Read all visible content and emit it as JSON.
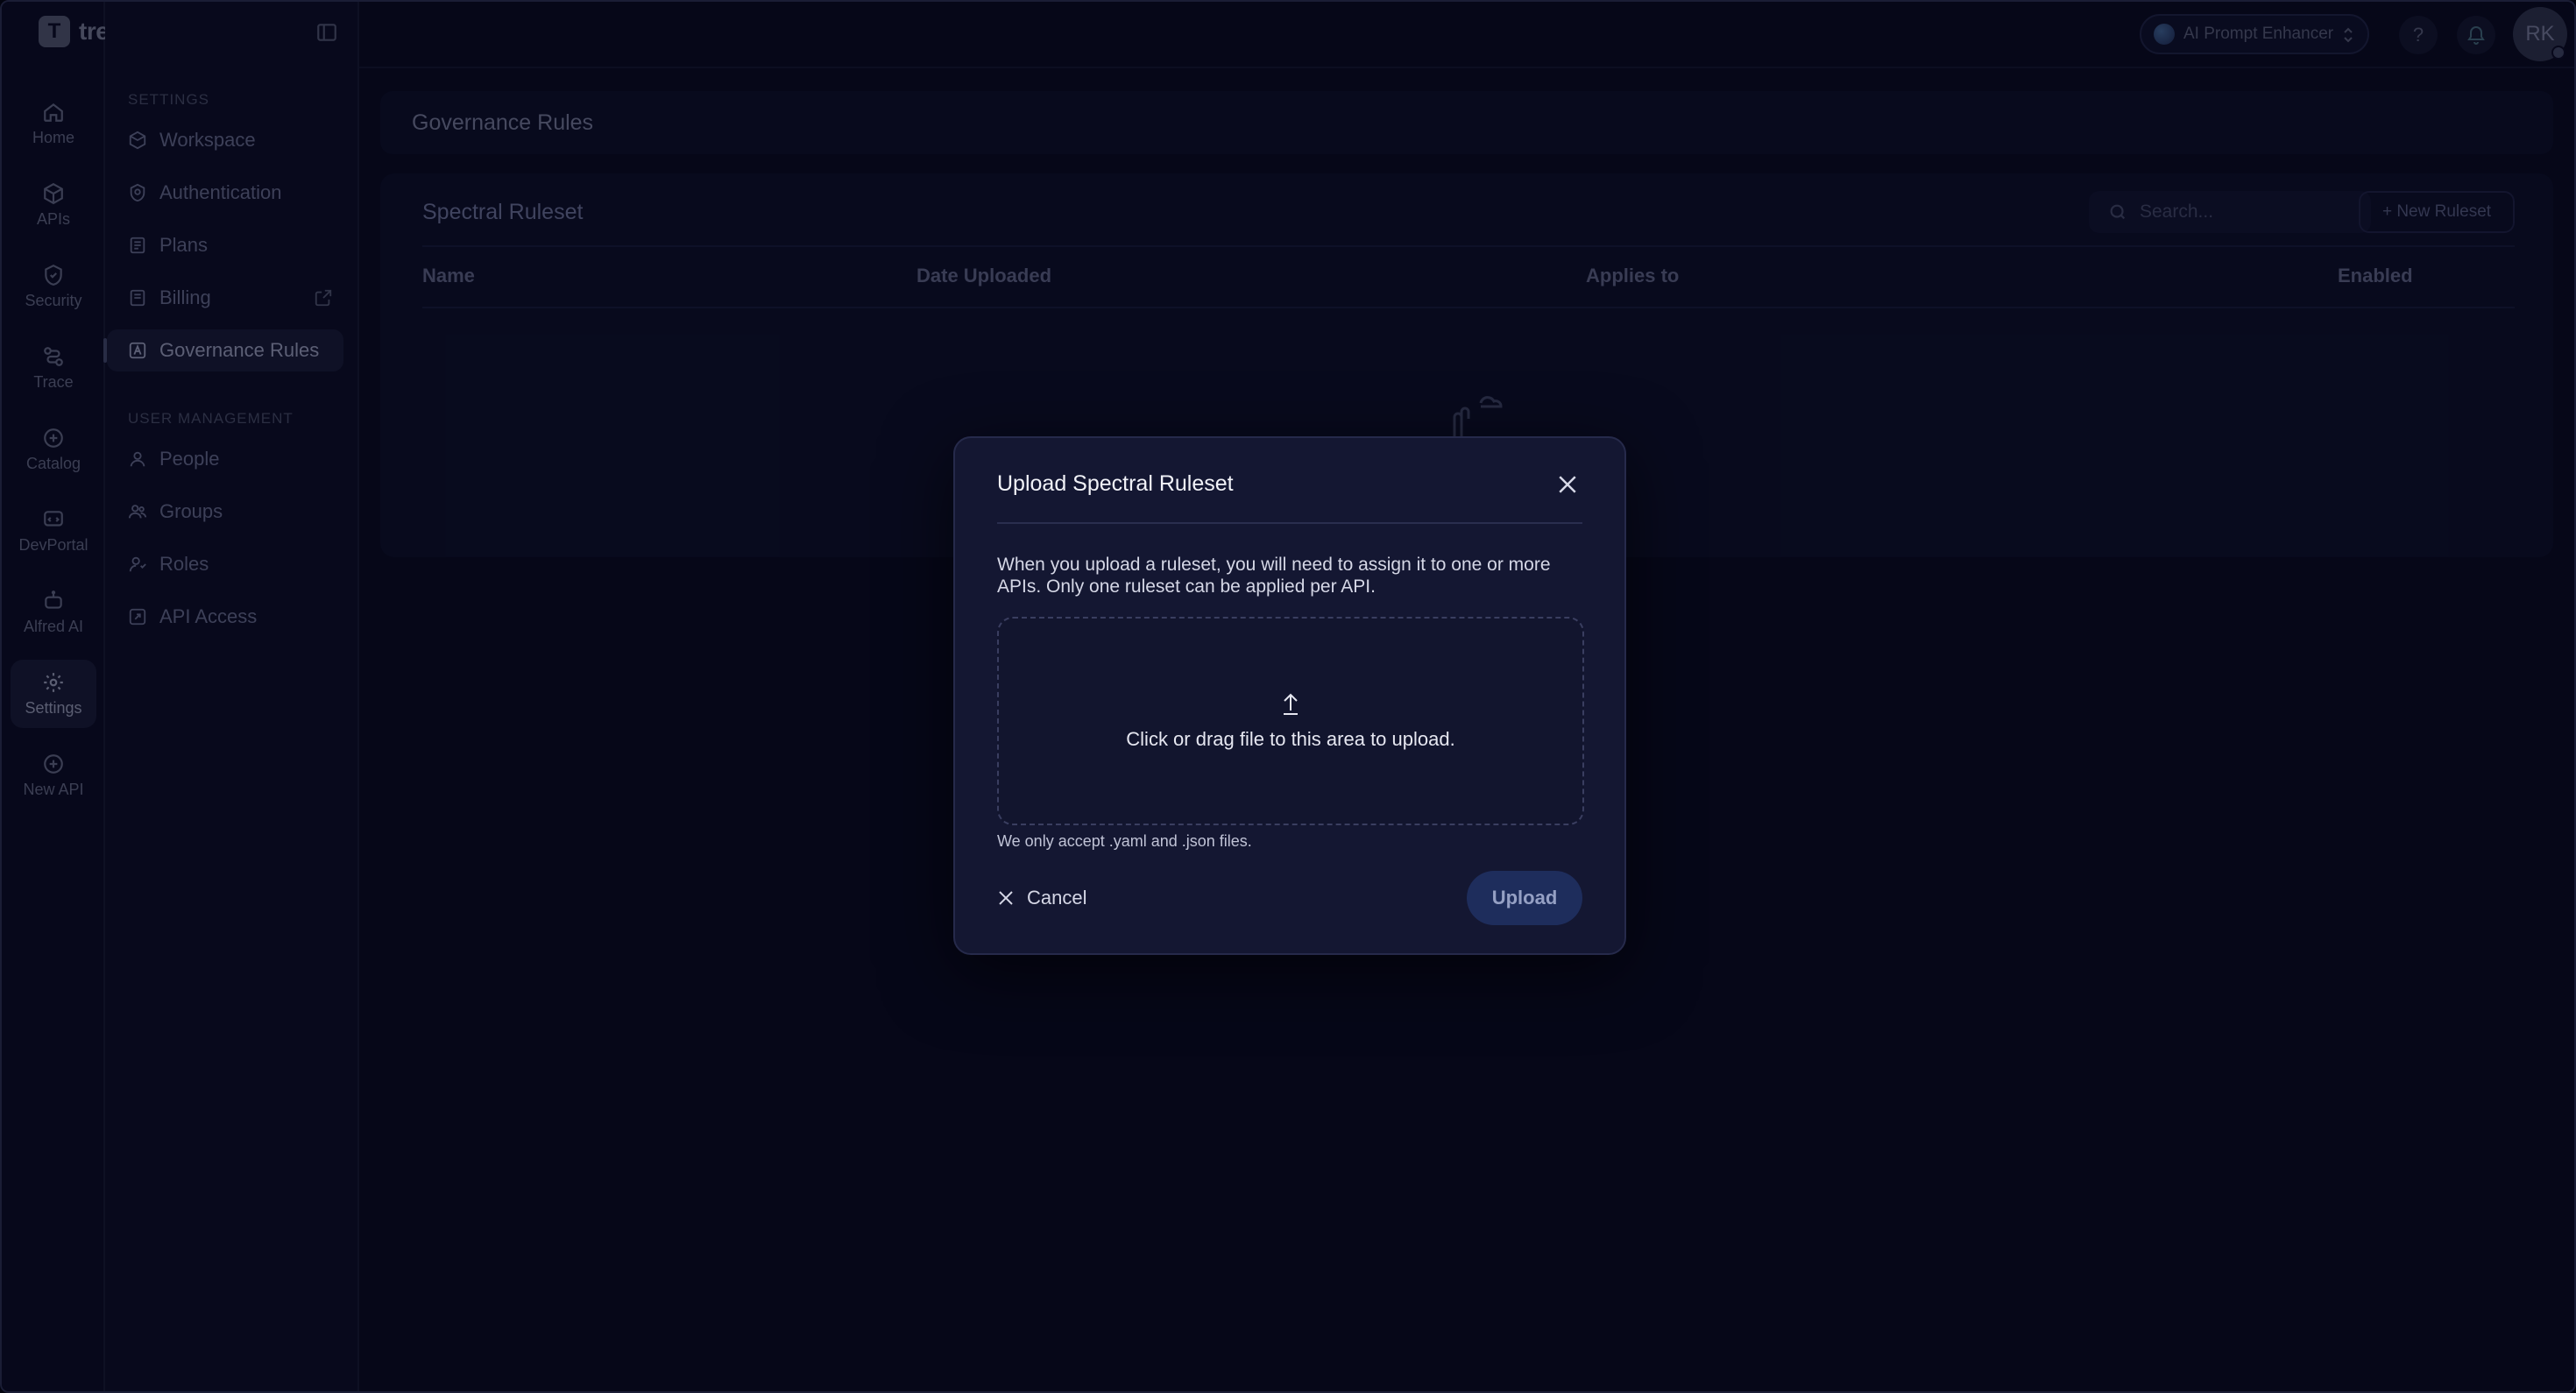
{
  "app": {
    "logo_text": "treblle",
    "logo_glyph": "T"
  },
  "rail": {
    "items": [
      {
        "label": "Home",
        "icon": "home-icon"
      },
      {
        "label": "APIs",
        "icon": "cube-icon"
      },
      {
        "label": "Security",
        "icon": "shield-icon"
      },
      {
        "label": "Trace",
        "icon": "trace-icon"
      },
      {
        "label": "Catalog",
        "icon": "catalog-icon"
      },
      {
        "label": "DevPortal",
        "icon": "devportal-icon"
      },
      {
        "label": "Alfred AI",
        "icon": "robot-icon"
      },
      {
        "label": "Settings",
        "icon": "gear-icon"
      },
      {
        "label": "New API",
        "icon": "plus-circle-icon"
      }
    ],
    "active": "Settings"
  },
  "subnav": {
    "settings_label": "SETTINGS",
    "settings_items": [
      {
        "label": "Workspace",
        "icon": "workspace-icon"
      },
      {
        "label": "Authentication",
        "icon": "fingerprint-icon"
      },
      {
        "label": "Plans",
        "icon": "plans-icon"
      },
      {
        "label": "Billing",
        "icon": "billing-icon"
      },
      {
        "label": "Governance Rules",
        "icon": "governance-icon"
      }
    ],
    "user_mgmt_label": "USER MANAGEMENT",
    "user_items": [
      {
        "label": "People",
        "icon": "person-icon"
      },
      {
        "label": "Groups",
        "icon": "group-icon"
      },
      {
        "label": "Roles",
        "icon": "roles-icon"
      },
      {
        "label": "API Access",
        "icon": "key-icon"
      }
    ],
    "active": "Governance Rules"
  },
  "topbar": {
    "enhancer_label": "AI Prompt Enhancer",
    "help_glyph": "?",
    "avatar_initials": "RK"
  },
  "page": {
    "title": "Governance Rules"
  },
  "card": {
    "title": "Spectral Ruleset",
    "search_placeholder": "Search...",
    "new_button": "+ New Ruleset",
    "columns": [
      "Name",
      "Date Uploaded",
      "Applies to",
      "Enabled"
    ]
  },
  "modal": {
    "title": "Upload Spectral Ruleset",
    "description": "When you upload a ruleset, you will need to assign it to one or more APIs. Only one ruleset can be applied per API.",
    "dropzone_text": "Click or drag file to this area to upload.",
    "hint": "We only accept .yaml and .json files.",
    "cancel_label": "Cancel",
    "upload_label": "Upload"
  },
  "colors": {
    "background": "#080a1e",
    "modal_bg": "#141732",
    "upload_btn": "#1e2d5c"
  }
}
